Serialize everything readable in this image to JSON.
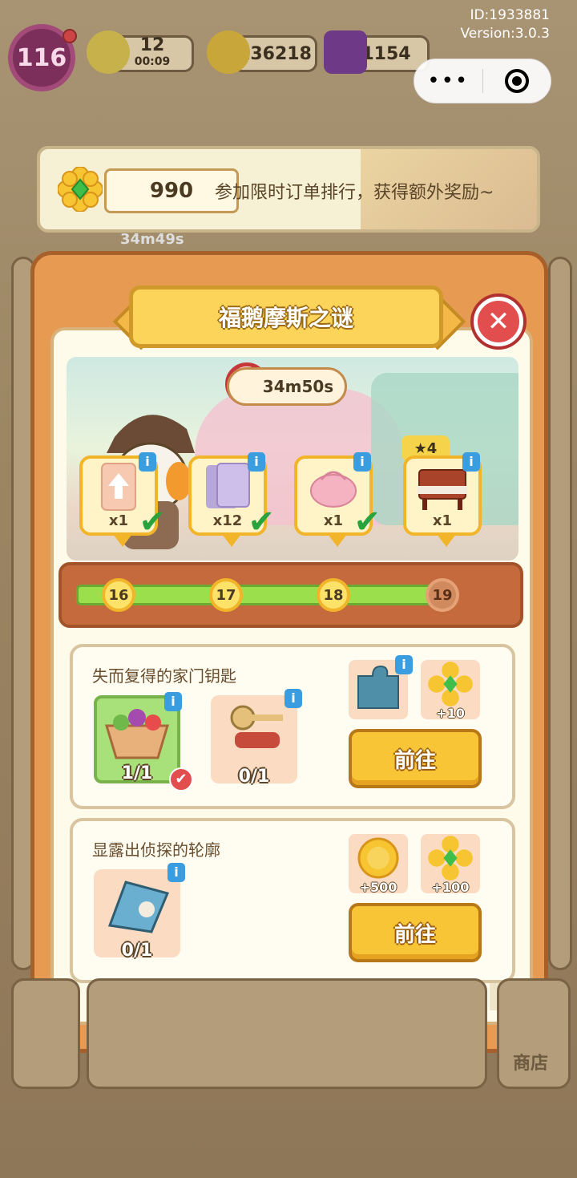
{
  "meta": {
    "id": "ID:1933881",
    "version": "Version:3.0.3"
  },
  "top_bar": {
    "level": "116",
    "energy": {
      "value": "12",
      "timer": "00:09"
    },
    "coins": "136218",
    "gems": "1154"
  },
  "capsule": {
    "more_icon": "more-dots-icon",
    "close_icon": "target-icon"
  },
  "banner": {
    "score": "990",
    "text": "参加限时订单排行，获得额外奖励~",
    "below_timer": "34m49s"
  },
  "panel": {
    "title": "福鹅摩斯之谜",
    "timer": "34m50s",
    "rewards": [
      {
        "count": "x1",
        "done": true,
        "icon": "upgrade-card-icon"
      },
      {
        "count": "x12",
        "done": true,
        "icon": "card-pack-icon"
      },
      {
        "count": "x1",
        "done": true,
        "icon": "bag-icon"
      },
      {
        "count": "x1",
        "done": false,
        "icon": "piano-icon",
        "stars": "4"
      }
    ],
    "progress": [
      "16",
      "17",
      "18",
      "19"
    ],
    "tasks": [
      {
        "title": "失而复得的家门钥匙",
        "items": [
          {
            "count": "1/1",
            "done": true,
            "icon": "salad-basket-icon"
          },
          {
            "count": "0/1",
            "done": false,
            "icon": "key-icon"
          }
        ],
        "rewards": [
          {
            "amount": "",
            "icon": "puzzle-piece-icon"
          },
          {
            "amount": "+10",
            "icon": "flower-gem-icon"
          }
        ],
        "button": "前往"
      },
      {
        "title": "显露出侦探的轮廓",
        "items": [
          {
            "count": "0/1",
            "done": false,
            "icon": "puzzle-detective-icon"
          }
        ],
        "rewards": [
          {
            "amount": "+500",
            "icon": "coin-icon"
          },
          {
            "amount": "+100",
            "icon": "flower-gem-icon"
          }
        ],
        "button": "前往"
      }
    ]
  },
  "bottom": {
    "shop_label": "商店"
  },
  "colors": {
    "accent": "#f8c537",
    "panel": "#e79a52",
    "check": "#29a33c"
  }
}
